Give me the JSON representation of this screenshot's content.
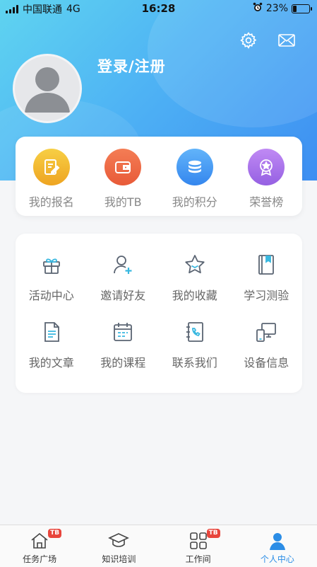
{
  "status_bar": {
    "carrier": "中国联通",
    "network": "4G",
    "time": "16:28",
    "battery": "23%",
    "battery_level": 0.23
  },
  "header": {
    "login_text": "登录/注册",
    "settings_icon": "gear-icon",
    "message_icon": "mail-icon"
  },
  "quick_links": [
    {
      "label": "我的报名",
      "icon": "edit-note-icon",
      "color": "#f2b62a"
    },
    {
      "label": "我的TB",
      "icon": "wallet-icon",
      "color": "#ee6a45"
    },
    {
      "label": "我的积分",
      "icon": "database-coins-icon",
      "color": "#3d8ef2"
    },
    {
      "label": "荣誉榜",
      "icon": "medal-icon",
      "color": "#a06be6"
    }
  ],
  "menu": [
    {
      "label": "活动中心",
      "icon": "gift-icon"
    },
    {
      "label": "邀请好友",
      "icon": "add-user-icon"
    },
    {
      "label": "我的收藏",
      "icon": "star-icon"
    },
    {
      "label": "学习测验",
      "icon": "bookmark-book-icon"
    },
    {
      "label": "我的文章",
      "icon": "document-icon"
    },
    {
      "label": "我的课程",
      "icon": "calendar-icon"
    },
    {
      "label": "联系我们",
      "icon": "phone-book-icon"
    },
    {
      "label": "设备信息",
      "icon": "devices-icon"
    }
  ],
  "tabbar": [
    {
      "label": "任务广场",
      "icon": "home-icon",
      "badge": "TB"
    },
    {
      "label": "知识培训",
      "icon": "graduation-cap-icon",
      "badge": ""
    },
    {
      "label": "工作间",
      "icon": "grid-apps-icon",
      "badge": "TB"
    },
    {
      "label": "个人中心",
      "icon": "person-icon",
      "badge": "",
      "active": true
    }
  ],
  "colors": {
    "accent": "#2b8de6",
    "menu_icon_stroke": "#5a6472",
    "menu_icon_accent": "#39b8e0",
    "badge": "#e8453c"
  }
}
